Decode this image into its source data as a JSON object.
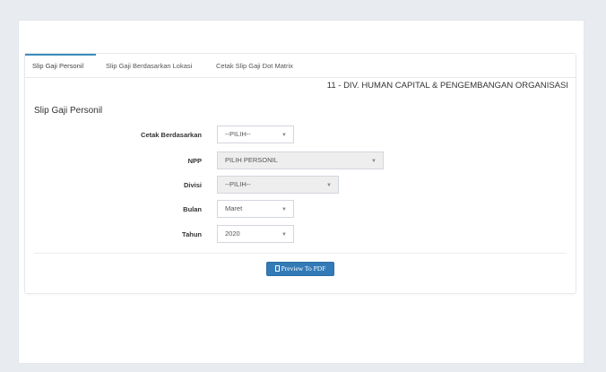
{
  "tabs": [
    {
      "label": "Slip Gaji Personil",
      "active": true
    },
    {
      "label": "Slip Gaji Berdasarkan Lokasi",
      "active": false
    },
    {
      "label": "Cetak Slip Gaji Dot Matrix",
      "active": false
    }
  ],
  "division": "11 - DIV. HUMAN CAPITAL & PENGEMBANGAN ORGANISASI",
  "section_title": "Slip Gaji Personil",
  "form": {
    "cetak_berdasarkan": {
      "label": "Cetak Berdasarkan",
      "value": "--PILIH--"
    },
    "npp": {
      "label": "NPP",
      "value": "PILIH PERSONIL"
    },
    "divisi": {
      "label": "Divisi",
      "value": "--PILIH--"
    },
    "bulan": {
      "label": "Bulan",
      "value": "Maret"
    },
    "tahun": {
      "label": "Tahun",
      "value": "2020"
    }
  },
  "buttons": {
    "preview": "Preview To PDF"
  },
  "icons": {
    "caret": "chevron-down-icon",
    "file": "file-icon"
  },
  "colors": {
    "accent": "#3c8dbc",
    "button": "#337ab7",
    "background": "#e8ecf0"
  }
}
